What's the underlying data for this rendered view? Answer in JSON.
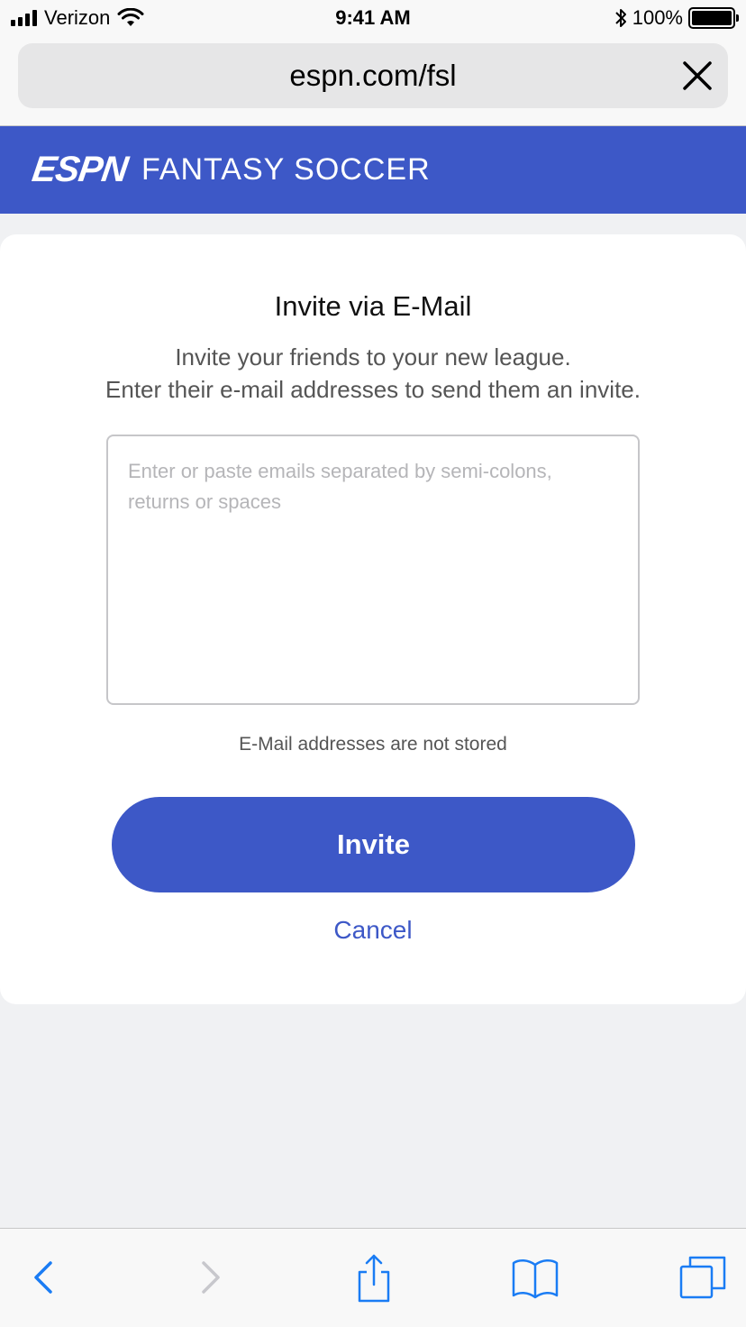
{
  "status_bar": {
    "carrier": "Verizon",
    "time": "9:41 AM",
    "battery": "100%",
    "battery_level": 1.0,
    "icons": [
      "signal-icon",
      "wifi-icon",
      "bluetooth-icon",
      "battery-icon"
    ]
  },
  "browser": {
    "url": "espn.com/fsl",
    "close_icon": "close-icon"
  },
  "brand": {
    "logo": "ESPN",
    "title": "FANTASY SOCCER"
  },
  "invite": {
    "title": "Invite via E-Mail",
    "description_line1": "Invite your friends to your new league.",
    "description_line2": "Enter their e-mail addresses to send them an invite.",
    "email_placeholder": "Enter or paste emails separated by semi-colons, returns or spaces",
    "email_value": "",
    "note": "E-Mail addresses are not stored",
    "invite_label": "Invite",
    "cancel_label": "Cancel"
  },
  "toolbar": {
    "icons": [
      "back-icon",
      "forward-icon",
      "share-icon",
      "bookmarks-icon",
      "tabs-icon"
    ]
  },
  "colors": {
    "brand": "#3d58c7",
    "ios_blue": "#1a7cf4",
    "disabled": "#c7c7cc"
  }
}
